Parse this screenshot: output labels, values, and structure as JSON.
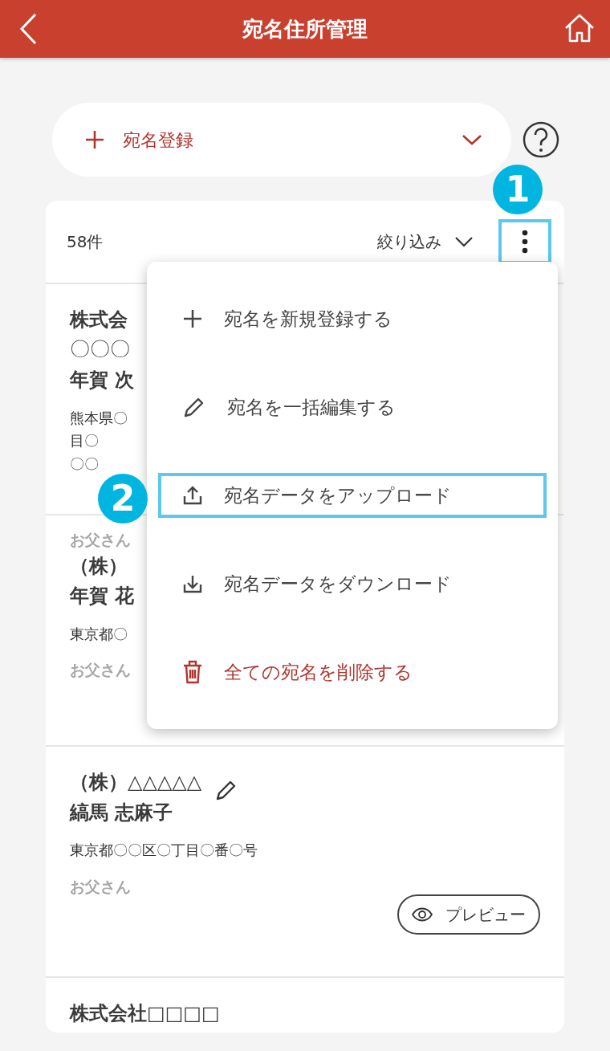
{
  "header": {
    "title": "宛名住所管理"
  },
  "register": {
    "label": "宛名登録"
  },
  "list": {
    "count": "58件",
    "filter": "絞り込み",
    "menu_highlighted": true
  },
  "cards": [
    {
      "company": "株式会",
      "line2": "〇〇〇",
      "name": "年賀 次",
      "address": [
        "熊本県〇",
        "目〇",
        "〇〇"
      ]
    },
    {
      "relation_top": "お父さん",
      "company": "（株）",
      "name": "年賀 花",
      "address": [
        "東京都〇"
      ],
      "relation": "お父さん"
    },
    {
      "company": "（株）△△△△△",
      "name": "縞馬 志麻子",
      "address": [
        "東京都〇〇区〇丁目〇番〇号"
      ],
      "relation": "お父さん",
      "editable": true,
      "preview": "プレビュー"
    },
    {
      "company": "株式会社□□□□"
    }
  ],
  "menu": {
    "items": [
      {
        "kind": "add",
        "label": "宛名を新規登録する",
        "highlighted": false
      },
      {
        "kind": "edit",
        "label": "宛名を一括編集する",
        "highlighted": false
      },
      {
        "kind": "upload",
        "label": "宛名データをアップロード",
        "highlighted": true
      },
      {
        "kind": "download",
        "label": "宛名データをダウンロード",
        "highlighted": false
      },
      {
        "kind": "delete",
        "label": "全ての宛名を削除する",
        "highlighted": false
      }
    ]
  },
  "callouts": [
    {
      "label": "1"
    },
    {
      "label": "2"
    }
  ]
}
